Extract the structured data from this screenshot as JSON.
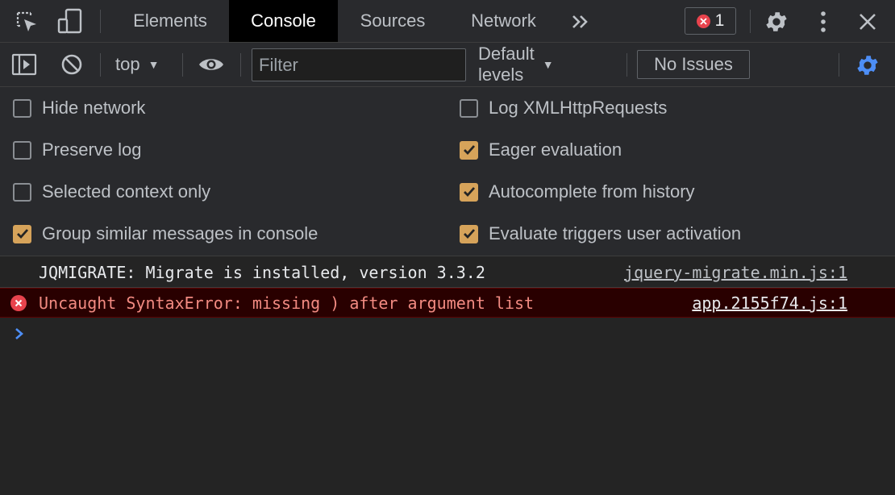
{
  "tabs": [
    {
      "label": "Elements",
      "active": false
    },
    {
      "label": "Console",
      "active": true
    },
    {
      "label": "Sources",
      "active": false
    },
    {
      "label": "Network",
      "active": false
    }
  ],
  "error_count": "1",
  "toolbar": {
    "context": "top",
    "filter_placeholder": "Filter",
    "levels": "Default levels",
    "issues": "No Issues"
  },
  "settings": {
    "left": [
      {
        "label": "Hide network",
        "checked": false
      },
      {
        "label": "Preserve log",
        "checked": false
      },
      {
        "label": "Selected context only",
        "checked": false
      },
      {
        "label": "Group similar messages in console",
        "checked": true
      }
    ],
    "right": [
      {
        "label": "Log XMLHttpRequests",
        "checked": false
      },
      {
        "label": "Eager evaluation",
        "checked": true
      },
      {
        "label": "Autocomplete from history",
        "checked": true
      },
      {
        "label": "Evaluate triggers user activation",
        "checked": true
      }
    ]
  },
  "messages": [
    {
      "level": "log",
      "text": "JQMIGRATE: Migrate is installed, version 3.3.2",
      "source": "jquery-migrate.min.js:1"
    },
    {
      "level": "error",
      "text": "Uncaught SyntaxError: missing ) after argument list",
      "source": "app.2155f74.js:1"
    }
  ],
  "colors": {
    "checkbox_checked": "#d6a35a",
    "error_red": "#e8434d",
    "accent_blue": "#4d8ef6"
  },
  "icons": [
    "inspect-element-icon",
    "device-toolbar-icon",
    "more-tabs-icon",
    "settings-icon",
    "kebab-menu-icon",
    "close-icon",
    "sidebar-toggle-icon",
    "clear-console-icon",
    "eye-icon",
    "console-settings-icon",
    "error-icon",
    "prompt-chevron-icon"
  ]
}
